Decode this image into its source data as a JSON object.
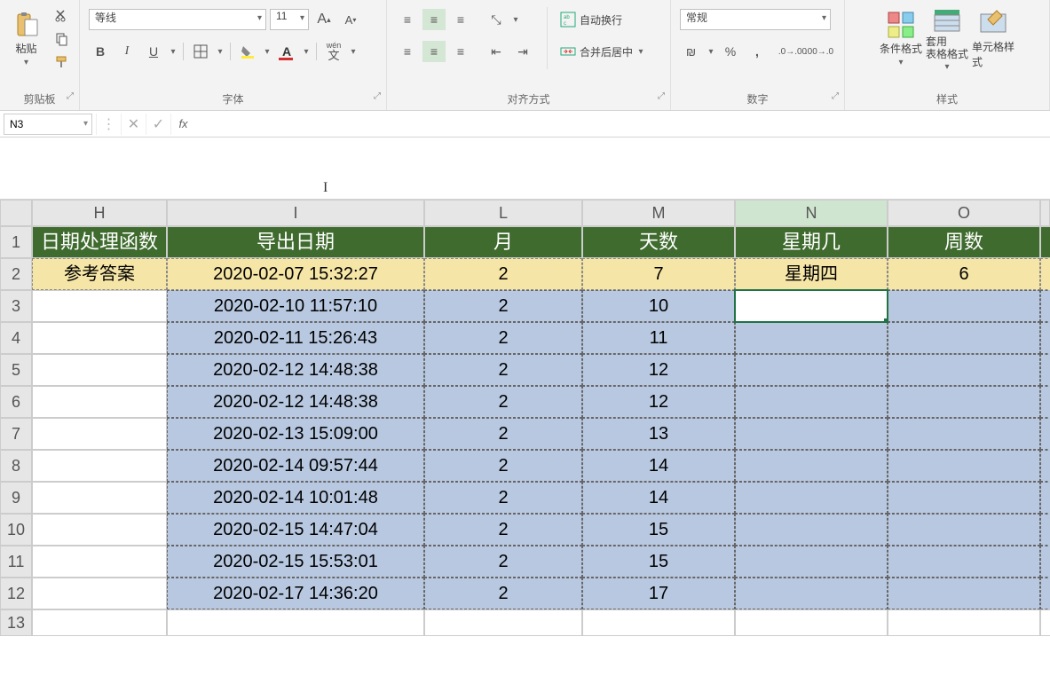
{
  "ribbon": {
    "clipboard": {
      "paste": "粘贴",
      "label": "剪贴板"
    },
    "font": {
      "name": "等线",
      "size": "11",
      "bold": "B",
      "italic": "I",
      "underline": "U",
      "phonetic": "wén",
      "label": "字体"
    },
    "align": {
      "wrap": "自动换行",
      "merge": "合并后居中",
      "label": "对齐方式"
    },
    "number": {
      "format": "常规",
      "label": "数字"
    },
    "styles": {
      "cond": "条件格式",
      "table": "套用\n表格格式",
      "cell": "单元格样式",
      "label": "样式"
    }
  },
  "namebox": "N3",
  "fx": "fx",
  "grid": {
    "cols": [
      "H",
      "I",
      "L",
      "M",
      "N",
      "O",
      ""
    ],
    "active_col": "N",
    "rowlabels": [
      "1",
      "2",
      "3",
      "4",
      "5",
      "6",
      "7",
      "8",
      "9",
      "10",
      "11",
      "12",
      "13"
    ],
    "header": {
      "H": "日期处理函数",
      "I": "导出日期",
      "L": "月",
      "M": "天数",
      "N": "星期几",
      "O": "周数"
    },
    "ref": {
      "H": "参考答案",
      "I": "2020-02-07 15:32:27",
      "L": "2",
      "M": "7",
      "N": "星期四",
      "O": "6"
    },
    "data": [
      {
        "I": "2020-02-10 11:57:10",
        "L": "2",
        "M": "10"
      },
      {
        "I": "2020-02-11 15:26:43",
        "L": "2",
        "M": "11"
      },
      {
        "I": "2020-02-12 14:48:38",
        "L": "2",
        "M": "12"
      },
      {
        "I": "2020-02-12 14:48:38",
        "L": "2",
        "M": "12"
      },
      {
        "I": "2020-02-13 15:09:00",
        "L": "2",
        "M": "13"
      },
      {
        "I": "2020-02-14 09:57:44",
        "L": "2",
        "M": "14"
      },
      {
        "I": "2020-02-14 10:01:48",
        "L": "2",
        "M": "14"
      },
      {
        "I": "2020-02-15 14:47:04",
        "L": "2",
        "M": "15"
      },
      {
        "I": "2020-02-15 15:53:01",
        "L": "2",
        "M": "15"
      },
      {
        "I": "2020-02-17 14:36:20",
        "L": "2",
        "M": "17"
      }
    ]
  }
}
